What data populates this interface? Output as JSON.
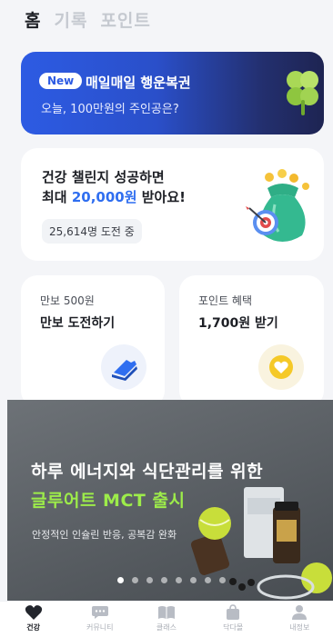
{
  "tabs": [
    "홈",
    "기록",
    "포인트"
  ],
  "lottery": {
    "badge": "New",
    "title": "매일매일 행운복권",
    "subtitle": "오늘, 100만원의 주인공은?"
  },
  "challenge": {
    "line1": "건강 챌린지 성공하면",
    "line2_prefix": "최대 ",
    "line2_amount": "20,000원",
    "line2_suffix": " 받아요!",
    "participants": "25,614명 도전 중"
  },
  "steps": {
    "subtitle": "만보 500원",
    "title": "만보 도전하기",
    "icon": "sneaker-icon"
  },
  "points": {
    "subtitle": "포인트 혜택",
    "title": "1,700원 받기",
    "icon": "heart-coin-icon"
  },
  "promo": {
    "line1": "하루 에너지와 식단관리를 위한",
    "line2": "글루어트 MCT 출시",
    "subtitle": "안정적인 인슐린 반응, 공복감 완화",
    "dot_count": 8,
    "active_dot": 0
  },
  "nav": [
    {
      "label": "건강",
      "icon": "heart-icon",
      "active": true
    },
    {
      "label": "커뮤니티",
      "icon": "chat-icon",
      "active": false
    },
    {
      "label": "클래스",
      "icon": "book-icon",
      "active": false
    },
    {
      "label": "닥다몰",
      "icon": "shopping-bag-icon",
      "active": false
    },
    {
      "label": "내정보",
      "icon": "person-icon",
      "active": false
    }
  ],
  "colors": {
    "accent": "#2f6ef0",
    "promo_green": "#9dec4a",
    "dark": "#1d1f25"
  }
}
